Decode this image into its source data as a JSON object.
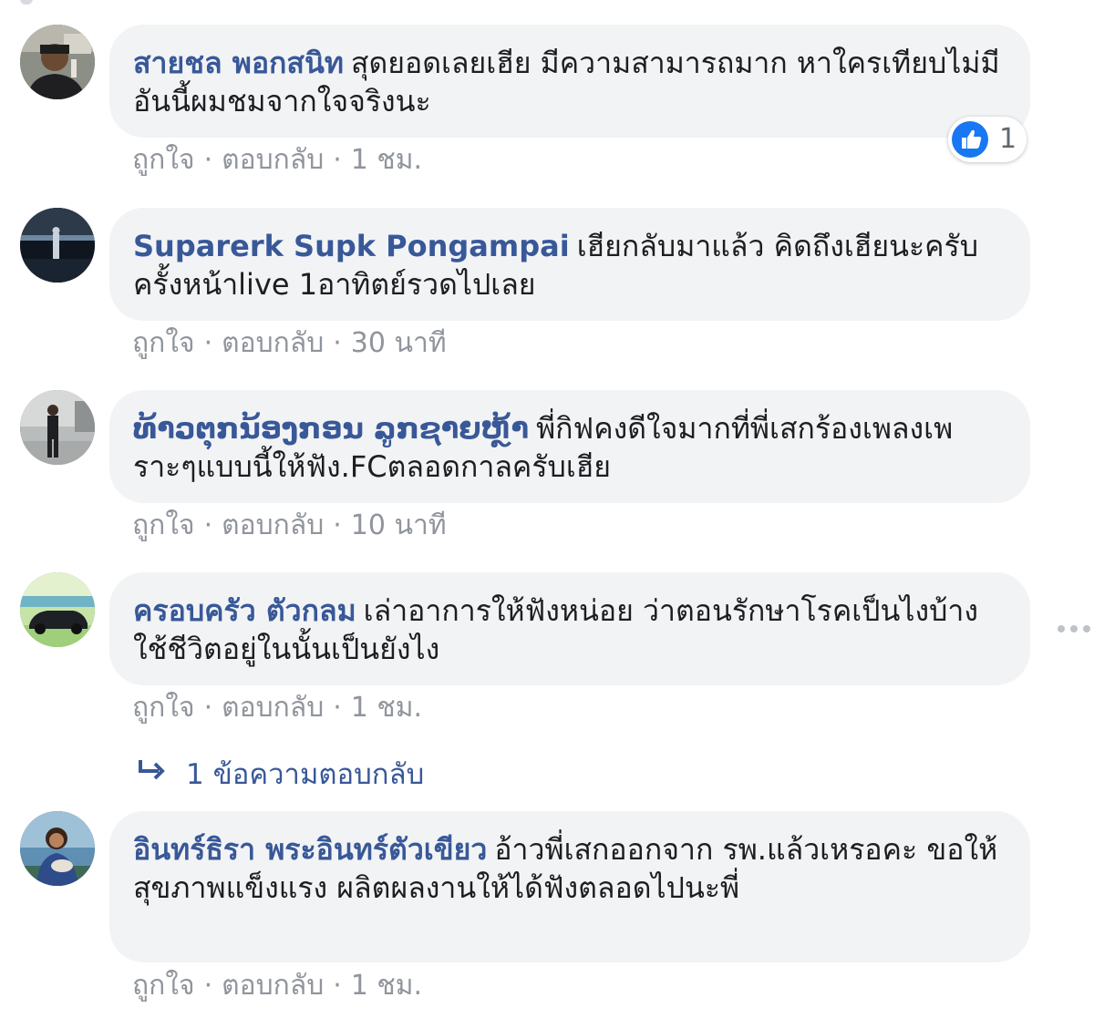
{
  "colors": {
    "author_link": "#385898",
    "bubble_bg": "#f2f3f5",
    "meta_text": "#90949c",
    "like_blue": "#1877f2"
  },
  "comments": [
    {
      "author": "สายชล พอกสนิท",
      "text": "สุดยอดเลยเฮีย มีความสามารถมาก หาใครเทียบไม่มี อันนี้ผมชมจากใจจริงนะ",
      "like_label": "ถูกใจ",
      "reply_label": "ตอบกลับ",
      "separator": "·",
      "time": "1 ชม.",
      "reaction": {
        "icon": "thumbs-up-icon",
        "count": "1"
      }
    },
    {
      "author": "Suparerk Supk Pongampai",
      "text": "เฮียกลับมาแล้ว คิดถึงเฮียนะครับ ครั้งหน้าlive 1อาทิตย์รวดไปเลย",
      "like_label": "ถูกใจ",
      "reply_label": "ตอบกลับ",
      "separator": "·",
      "time": "30 นาที"
    },
    {
      "author": "ທ້າວຕຸກນ້ອງກອນ ລູກຊາຍຫຼ້າ",
      "text": "พี่กิฟคงดีใจมากที่พี่เสกร้องเพลงเพราะๆแบบนี้ให้ฟัง.FCตลอดกาลครับเฮีย",
      "like_label": "ถูกใจ",
      "reply_label": "ตอบกลับ",
      "separator": "·",
      "time": "10 นาที"
    },
    {
      "author": "ครอบครัว ตัวกลม",
      "text": "เล่าอาการให้ฟังหน่อย ว่าตอนรักษาโรคเป็นไงบ้าง ใช้ชีวิตอยู่ในนั้นเป็นยังไง",
      "like_label": "ถูกใจ",
      "reply_label": "ตอบกลับ",
      "separator": "·",
      "time": "1 ชม.",
      "replies_link": "1 ข้อความตอบกลับ"
    },
    {
      "author": "อินทร์ธิรา พระอินทร์ตัวเขียว",
      "text": "อ้าวพี่เสกออกจาก รพ.แล้วเหรอคะ ขอให้สุขภาพแข็งแรง ผลิตผลงานให้ได้ฟังตลอดไปนะพี่",
      "like_label": "ถูกใจ",
      "reply_label": "ตอบกลับ",
      "separator": "·",
      "time": "1 ชม."
    }
  ]
}
